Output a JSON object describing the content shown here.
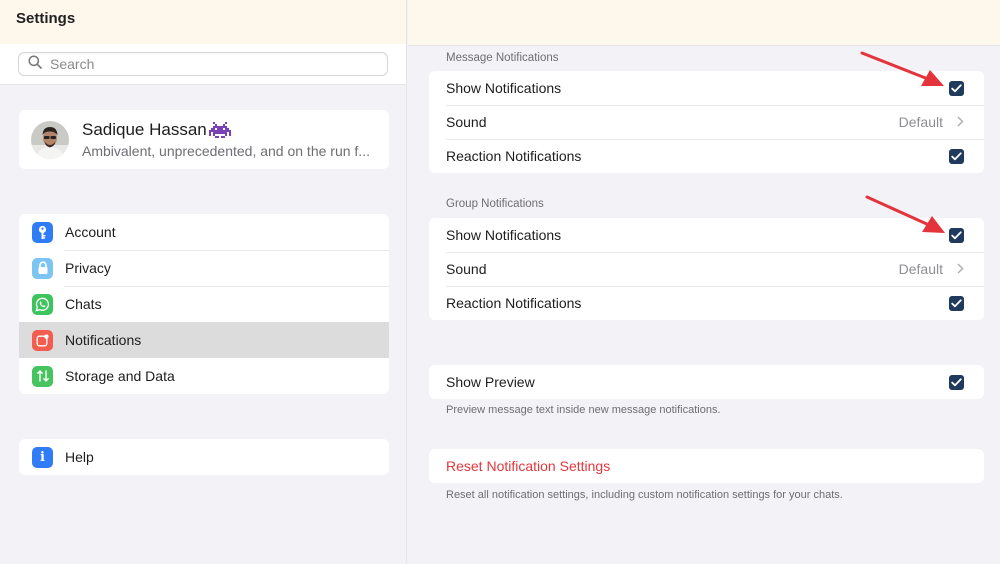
{
  "sidebar": {
    "title": "Settings",
    "search_placeholder": "Search",
    "profile": {
      "name": "Sadique Hassan",
      "status": "Ambivalent, unprecedented, and on the run f..."
    },
    "items": [
      {
        "label": "Account",
        "icon": "key-icon",
        "color": "#2f7cf6"
      },
      {
        "label": "Privacy",
        "icon": "lock-icon",
        "color": "#7cc5f3"
      },
      {
        "label": "Chats",
        "icon": "whatsapp-icon",
        "color": "#3dc45e"
      },
      {
        "label": "Notifications",
        "icon": "notification-icon",
        "color": "#f25d4f",
        "selected": true
      },
      {
        "label": "Storage and Data",
        "icon": "arrows-updown-icon",
        "color": "#47c35f"
      }
    ],
    "help": {
      "label": "Help",
      "icon": "info-icon",
      "color": "#2f7cf6"
    }
  },
  "main": {
    "message_notifications": {
      "header": "Message Notifications",
      "rows": [
        {
          "label": "Show Notifications",
          "checked": true
        },
        {
          "label": "Sound",
          "value": "Default"
        },
        {
          "label": "Reaction Notifications",
          "checked": true
        }
      ]
    },
    "group_notifications": {
      "header": "Group Notifications",
      "rows": [
        {
          "label": "Show Notifications",
          "checked": true
        },
        {
          "label": "Sound",
          "value": "Default"
        },
        {
          "label": "Reaction Notifications",
          "checked": true
        }
      ]
    },
    "preview": {
      "label": "Show Preview",
      "checked": true,
      "footnote": "Preview message text inside new message notifications."
    },
    "reset": {
      "label": "Reset Notification Settings",
      "footnote": "Reset all notification settings, including custom notification settings for your chats."
    }
  },
  "colors": {
    "accent_red": "#e0383e",
    "checkbox": "#1f3a5c",
    "annotation_arrow": "#e5333b",
    "titlebar": "#fdf7ec"
  }
}
